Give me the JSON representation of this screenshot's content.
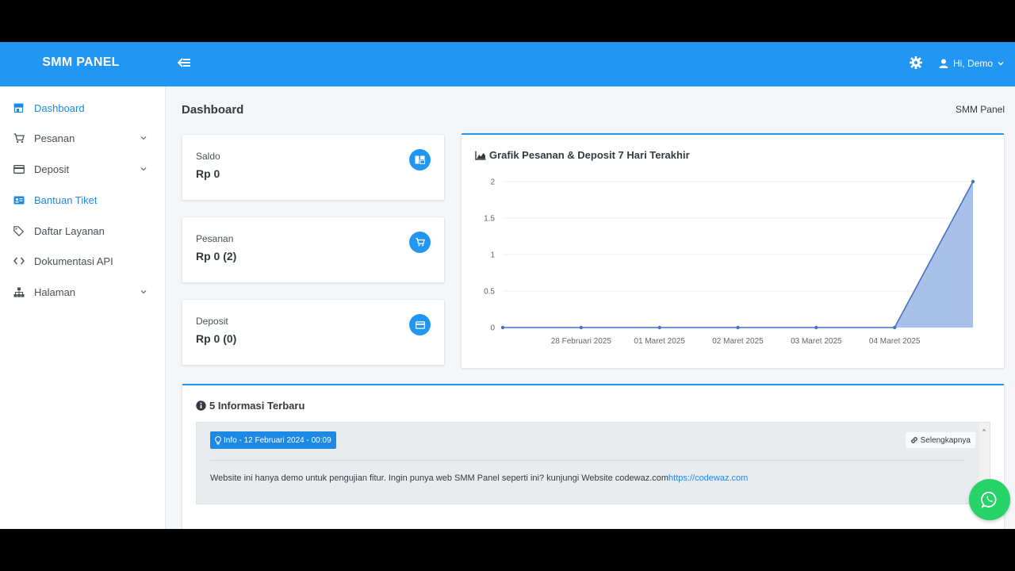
{
  "app": {
    "brand": "SMM PANEL",
    "user_greeting": "Hi, Demo"
  },
  "sidebar": {
    "items": [
      {
        "label": "Dashboard",
        "icon": "store-icon"
      },
      {
        "label": "Pesanan",
        "icon": "cart-icon"
      },
      {
        "label": "Deposit",
        "icon": "credit-card-icon"
      },
      {
        "label": "Bantuan Tiket",
        "icon": "ticket-icon"
      },
      {
        "label": "Daftar Layanan",
        "icon": "tag-icon"
      },
      {
        "label": "Dokumentasi API",
        "icon": "code-icon"
      },
      {
        "label": "Halaman",
        "icon": "sitemap-icon"
      }
    ]
  },
  "page": {
    "title": "Dashboard",
    "breadcrumb": "SMM Panel"
  },
  "stats": [
    {
      "label": "Saldo",
      "value": "Rp 0",
      "icon": "wallet-icon"
    },
    {
      "label": "Pesanan",
      "value": "Rp 0 (2)",
      "icon": "cart-icon"
    },
    {
      "label": "Deposit",
      "value": "Rp 0 (0)",
      "icon": "credit-card-icon"
    }
  ],
  "chart_card": {
    "title": "Grafik Pesanan & Deposit 7 Hari Terakhir"
  },
  "chart_data": {
    "type": "area",
    "title": "Grafik Pesanan & Deposit 7 Hari Terakhir",
    "x_tick_labels": [
      "28 Februari 2025",
      "01 Maret 2025",
      "02 Maret 2025",
      "03 Maret 2025",
      "04 Maret 2025"
    ],
    "y_tick_labels": [
      "0",
      "0.5",
      "1",
      "1.5",
      "2"
    ],
    "ylim": [
      0,
      2
    ],
    "grid": true,
    "series": [
      {
        "values": [
          0,
          0,
          0,
          0,
          0,
          0,
          2
        ],
        "color": "#4472c4",
        "fill": "#a4bde8"
      }
    ]
  },
  "info": {
    "title": "5 Informasi Terbaru",
    "items": [
      {
        "badge": "Info - 12 Februari 2024 - 00:09",
        "more_label": "Selengkapnya",
        "text": "Website ini hanya demo untuk pengujian fitur. Ingin punya web SMM Panel seperti ini? kunjungi Website codewaz.com",
        "link": "https://codewaz.com"
      }
    ]
  },
  "colors": {
    "primary": "#2196f3",
    "whatsapp": "#25d366"
  }
}
